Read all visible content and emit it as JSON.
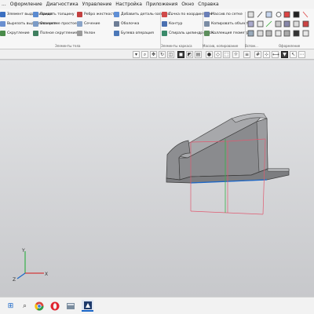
{
  "menu": [
    "...",
    "Оформление",
    "Диагностика",
    "Управление",
    "Настройка",
    "Приложения",
    "Окно",
    "Справка"
  ],
  "ribbon": {
    "col1": [
      "Элемент выдавливания",
      "Вырезать выдавливанием",
      "Скругление"
    ],
    "col2": [
      "Придать толщину",
      "Отверстие простое",
      "Полное скругление"
    ],
    "col3": [
      "Ребро жесткости",
      "Сечение",
      "Уклон"
    ],
    "col4": [
      "Добавить деталь-заготов...",
      "Оболочка",
      "Булева операция"
    ],
    "col5": [
      "Точка по координатам",
      "Контур",
      "Спираль цилиндрическ..."
    ],
    "col6": [
      "Массив по сетке",
      "Копировать объекты",
      "Коллекция геометрии"
    ],
    "groups": {
      "solid": "Элементы тела",
      "frame": "Элементы каркаса",
      "array": "Массив, копирование",
      "aux": "Вспом...",
      "styles": "Оформление"
    }
  },
  "axes": {
    "x": "X",
    "y": "Y",
    "z": "Z"
  },
  "colors": {
    "accent": "#1a66c7",
    "model_fill": "#8e8f92",
    "bbox": "#e05a70",
    "axis_green": "#37b04a",
    "axis_red": "#d23b3b"
  },
  "taskbar": {
    "apps": [
      "windows-icon",
      "search-icon",
      "chrome-icon",
      "opera-icon",
      "file-manager-icon",
      "kompas-icon"
    ]
  }
}
